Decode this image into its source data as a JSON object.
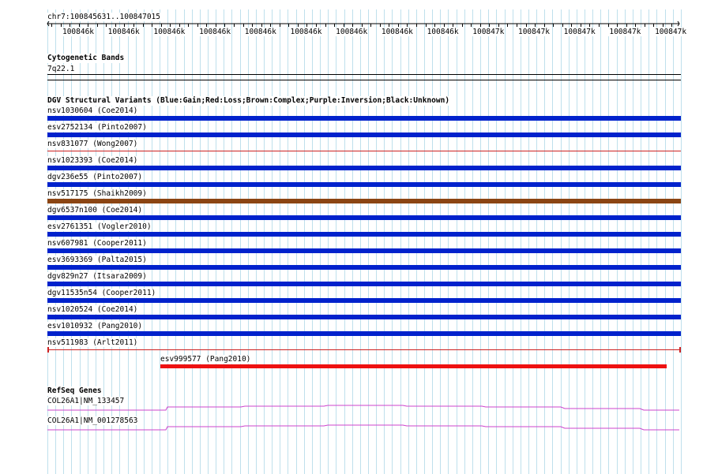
{
  "location": "chr7:100845631..100847015",
  "ruler": {
    "ticks": [
      "100846k",
      "100846k",
      "100846k",
      "100846k",
      "100846k",
      "100846k",
      "100846k",
      "100846k",
      "100846k",
      "100847k",
      "100847k",
      "100847k",
      "100847k",
      "100847k"
    ]
  },
  "cytoband": {
    "title": "Cytogenetic Bands",
    "band": "7q22.1"
  },
  "dgv": {
    "title": "DGV Structural Variants (Blue:Gain;Red:Loss;Brown:Complex;Purple:Inversion;Black:Unknown)",
    "colors": {
      "gain": "#0022cc",
      "loss": "#ee1111",
      "complex": "#8b4513",
      "loss_line": "#cc2222"
    },
    "variants": [
      {
        "label": "nsv1030604 (Coe2014)",
        "type": "gain"
      },
      {
        "label": "esv2752134 (Pinto2007)",
        "type": "gain"
      },
      {
        "label": "nsv831077 (Wong2007)",
        "type": "loss"
      },
      {
        "label": "nsv1023393 (Coe2014)",
        "type": "gain"
      },
      {
        "label": "dgv236e55 (Pinto2007)",
        "type": "gain"
      },
      {
        "label": "nsv517175 (Shaikh2009)",
        "type": "complex"
      },
      {
        "label": "dgv6537n100 (Coe2014)",
        "type": "gain"
      },
      {
        "label": "esv2761351 (Vogler2010)",
        "type": "gain"
      },
      {
        "label": "nsv607981 (Cooper2011)",
        "type": "gain"
      },
      {
        "label": "esv3693369 (Palta2015)",
        "type": "gain"
      },
      {
        "label": "dgv829n27 (Itsara2009)",
        "type": "gain"
      },
      {
        "label": "dgv11535n54 (Cooper2011)",
        "type": "gain"
      },
      {
        "label": "nsv1020524 (Coe2014)",
        "type": "gain"
      },
      {
        "label": "esv1010932 (Pang2010)",
        "type": "gain"
      },
      {
        "label": "nsv511983 (Arlt2011)",
        "type": "loss"
      },
      {
        "label": "esv999577 (Pang2010)",
        "type": "loss"
      }
    ]
  },
  "refseq": {
    "title": "RefSeq Genes",
    "color": "#cc44cc",
    "genes": [
      {
        "label": "COL26A1|NM_133457"
      },
      {
        "label": "COL26A1|NM_001278563"
      }
    ]
  }
}
